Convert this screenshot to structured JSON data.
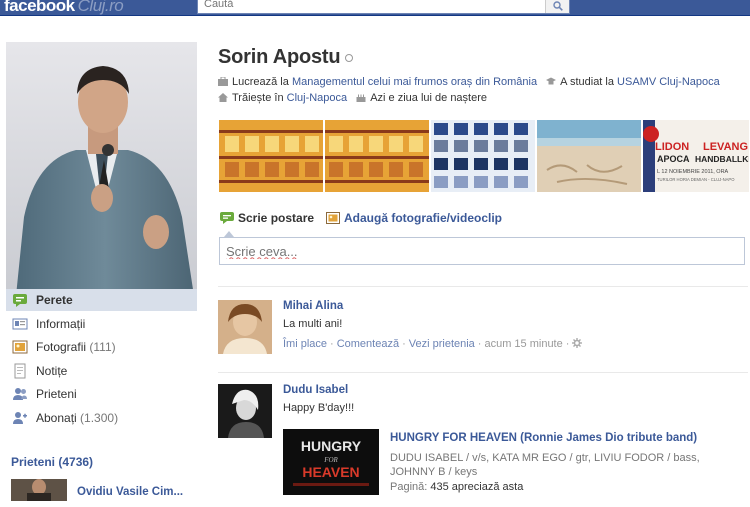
{
  "header": {
    "logo_text": "facebook",
    "logo_city": "Cluj.ro",
    "search_placeholder": "Caută"
  },
  "sidebar": {
    "nav": [
      {
        "label": "Perete",
        "count": "",
        "icon": "wall-icon",
        "active": true
      },
      {
        "label": "Informații",
        "count": "",
        "icon": "info-icon"
      },
      {
        "label": "Fotografii",
        "count": "(111)",
        "icon": "photos-icon"
      },
      {
        "label": "Notițe",
        "count": "",
        "icon": "notes-icon"
      },
      {
        "label": "Prieteni",
        "count": "",
        "icon": "friends-icon"
      },
      {
        "label": "Abonați",
        "count": "(1.300)",
        "icon": "subscribers-icon"
      }
    ],
    "friends_heading": "Prieteni (4736)",
    "friend_preview_name": "Ovidiu Vasile Cim..."
  },
  "profile": {
    "name": "Sorin Apostu",
    "info": {
      "work_prefix": "Lucrează la ",
      "work_link": "Managementul celui mai frumos oraș din România",
      "study_prefix": "A studiat la ",
      "study_link": "USAMV Cluj-Napoca",
      "lives_prefix": "Trăiește în ",
      "lives_link": "Cluj-Napoca",
      "birthday": "Azi e ziua lui de naștere"
    }
  },
  "composer": {
    "tab_post": "Scrie postare",
    "tab_photo": "Adaugă fotografie/videoclip",
    "placeholder": "Scrie ceva..."
  },
  "posts": [
    {
      "author": "Mihai Alina",
      "text": "La multi ani!",
      "actions": [
        "Îmi place",
        "Comentează",
        "Vezi prietenia"
      ],
      "time": "acum 15 minute"
    },
    {
      "author": "Dudu Isabel",
      "text": "Happy B'day!!!",
      "attachment": {
        "image_line1": "HUNGRY",
        "image_line2": "FOR",
        "image_line3": "HEAVEN",
        "title": "HUNGRY FOR HEAVEN (Ronnie James Dio tribute band)",
        "description": "DUDU ISABEL / v/s, KATA MR EGO / gtr, LIVIU FODOR / bass, JOHNNY B / keys",
        "meta_label": "Pagină:",
        "meta_value": "435 apreciază asta"
      }
    }
  ],
  "photostrip_texts": {
    "poster_line1": "LIDON",
    "poster_line2": "LEVANG",
    "poster_line3": "APOCA",
    "poster_line4": "HANDBALLKI",
    "poster_line5": "L 12 NOIEMBRIE 2011, ORA",
    "poster_line6": "TURILOR HORIA DEMIAN - CLUJ-NAPO"
  },
  "colors": {
    "brand": "#3b5998",
    "link": "#3b5998",
    "nav_active": "#d8dfea"
  }
}
